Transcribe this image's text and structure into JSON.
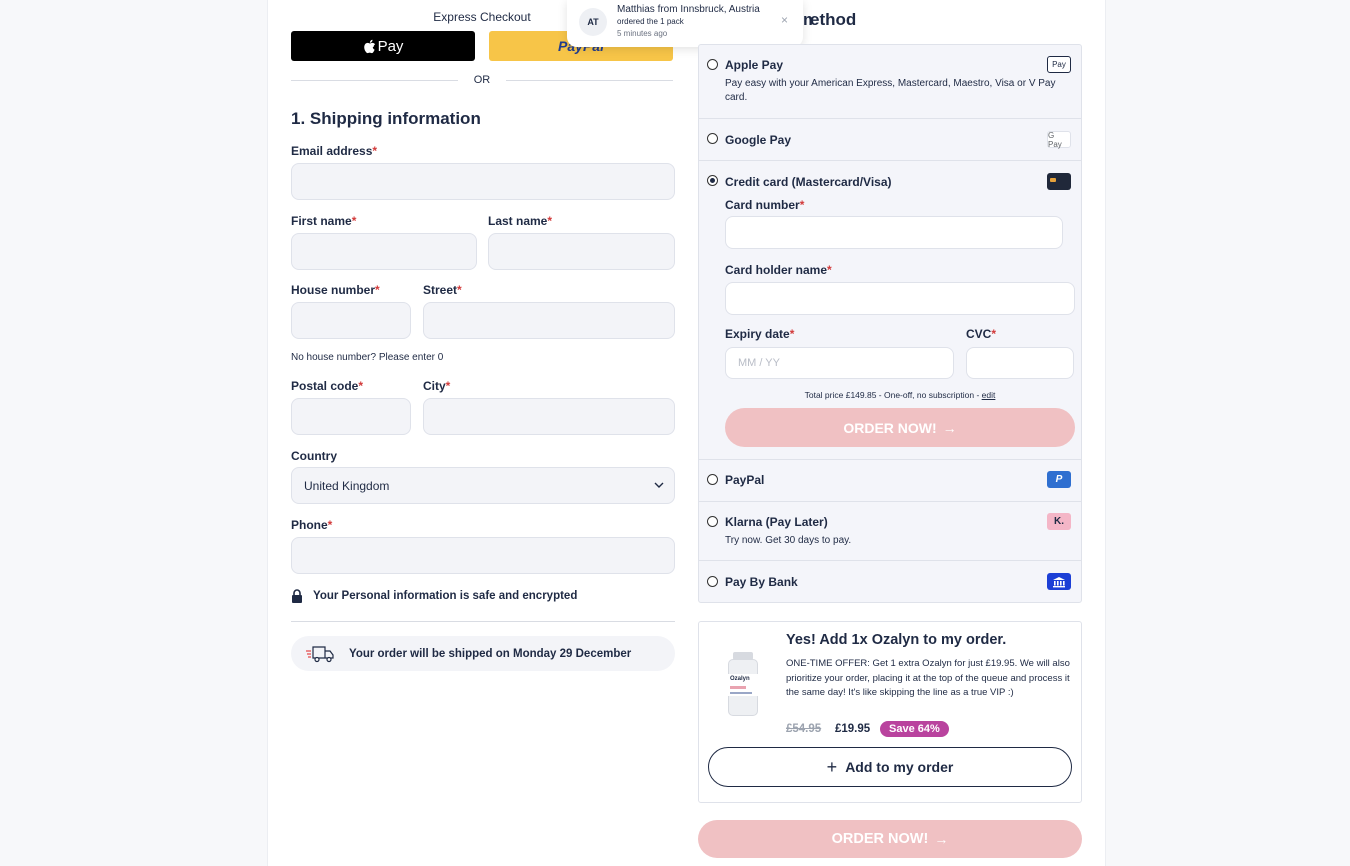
{
  "express": {
    "title": "Express Checkout",
    "apple_pay_label": "Pay",
    "paypal_label": "PayPal",
    "or_label": "OR"
  },
  "notification": {
    "initials": "AT",
    "name": "Matthias from Innsbruck, Austria",
    "action": "ordered the 1 pack",
    "time": "5 minutes ago"
  },
  "shipping": {
    "title": "1. Shipping information",
    "email_label": "Email address",
    "first_name_label": "First name",
    "last_name_label": "Last name",
    "house_number_label": "House number",
    "street_label": "Street",
    "house_hint": "No house number? Please enter 0",
    "postal_label": "Postal code",
    "city_label": "City",
    "country_label": "Country",
    "country_value": "United Kingdom",
    "phone_label": "Phone",
    "secure_note": "Your Personal information is safe and encrypted",
    "ship_note": "Your order will be shipped on Monday 29 December",
    "required_mark": "*"
  },
  "payment": {
    "title_fragment": "ethod",
    "methods": [
      {
        "name": "Apple Pay",
        "desc": "Pay easy with your American Express, Mastercard, Maestro, Visa or V Pay card.",
        "icon": "apple-pay-icon",
        "icon_text": "Pay"
      },
      {
        "name": "Google Pay",
        "icon": "google-pay-icon",
        "icon_text": "G Pay"
      },
      {
        "name": "Credit card (Mastercard/Visa)",
        "icon": "credit-card-icon",
        "selected": true
      },
      {
        "name": "PayPal",
        "icon": "paypal-icon",
        "icon_text": "P"
      },
      {
        "name": "Klarna (Pay Later)",
        "desc": "Try now. Get 30 days to pay.",
        "icon": "klarna-icon",
        "icon_text": "K."
      },
      {
        "name": "Pay By Bank",
        "icon": "bank-icon"
      }
    ],
    "card": {
      "number_label": "Card number",
      "holder_label": "Card holder name",
      "expiry_label": "Expiry date",
      "expiry_placeholder": "MM / YY",
      "cvc_label": "CVC",
      "total_text": "Total price £149.85 - One-off, no subscription -",
      "edit_label": "edit",
      "order_button": "ORDER NOW!"
    },
    "colors": {
      "paypal": "#2f6fd0",
      "klarna": "#f4b6c7",
      "bank": "#1c3fd6",
      "order_disabled": "#f0c1c3"
    }
  },
  "upsell": {
    "title": "Yes! Add 1x Ozalyn to my order.",
    "text": "ONE-TIME OFFER: Get 1 extra Ozalyn for just £19.95. We will also prioritize your order, placing it at the top of the queue and process it the same day! It's like skipping the line as a true VIP :)",
    "old_price": "£54.95",
    "new_price": "£19.95",
    "badge": "Save 64%",
    "button": "Add to my order",
    "bottle_label": "Ozalyn"
  },
  "bottom": {
    "order_button": "ORDER NOW!"
  }
}
